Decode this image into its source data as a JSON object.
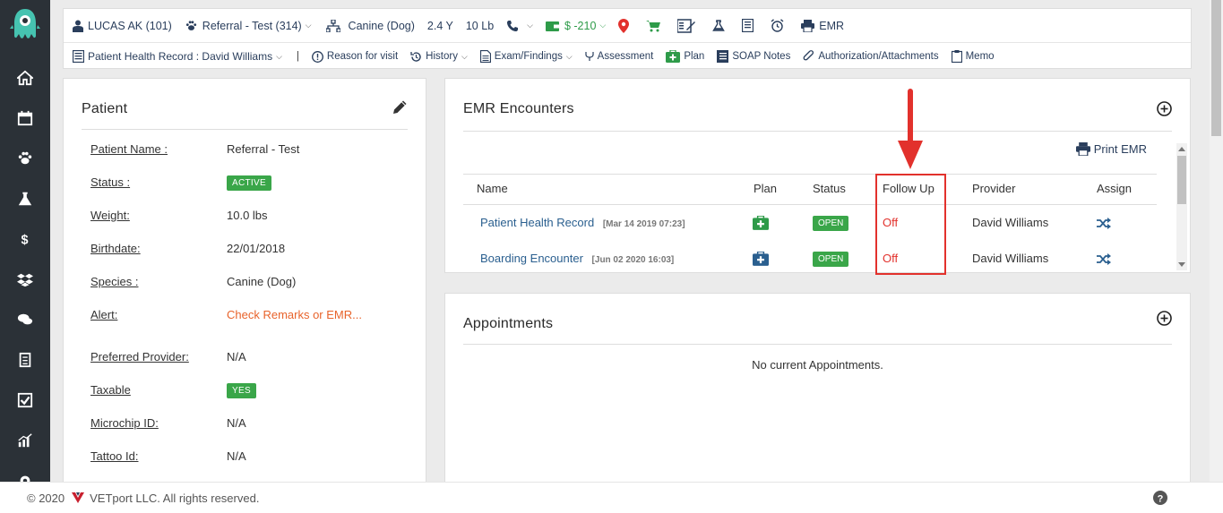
{
  "header": {
    "patient_owner": "LUCAS AK (101)",
    "patient_name": "Referral - Test (314)",
    "species": "Canine (Dog)",
    "age": "2.4 Y",
    "weight": "10 Lb",
    "balance": "$ -210",
    "emr_label": "EMR"
  },
  "subnav": {
    "record": "Patient Health Record : David Williams",
    "reason": "Reason for visit",
    "history": "History",
    "exam": "Exam/Findings",
    "assessment": "Assessment",
    "plan": "Plan",
    "soap": "SOAP Notes",
    "auth": "Authorization/Attachments",
    "memo": "Memo"
  },
  "patient": {
    "title": "Patient",
    "fields": [
      {
        "label": "Patient Name :",
        "value": "Referral - Test"
      },
      {
        "label": "Status :",
        "value": "ACTIVE"
      },
      {
        "label": "Weight:",
        "value": "10.0 lbs"
      },
      {
        "label": "Birthdate:",
        "value": "22/01/2018"
      },
      {
        "label": "Species :",
        "value": "Canine (Dog)"
      },
      {
        "label": "Alert:",
        "value": "Check Remarks or EMR..."
      },
      {
        "label": "Preferred Provider:",
        "value": "N/A"
      },
      {
        "label": "Taxable",
        "value": "YES"
      },
      {
        "label": "Microchip ID:",
        "value": "N/A"
      },
      {
        "label": "Tattoo Id:",
        "value": "N/A"
      }
    ]
  },
  "emr": {
    "title": "EMR Encounters",
    "print": "Print EMR",
    "columns": [
      "Name",
      "Plan",
      "Status",
      "Follow Up",
      "Provider",
      "Assign"
    ],
    "rows": [
      {
        "name": "Patient Health Record",
        "date": "[Mar 14 2019 07:23]",
        "status": "OPEN",
        "follow_up": "Off",
        "provider": "David Williams"
      },
      {
        "name": "Boarding Encounter",
        "date": "[Jun 02 2020 16:03]",
        "status": "OPEN",
        "follow_up": "Off",
        "provider": "David Williams"
      }
    ]
  },
  "appointments": {
    "title": "Appointments",
    "empty": "No current Appointments."
  },
  "footer": {
    "copyright": "© 2020",
    "company": "VETport LLC. All rights reserved."
  },
  "colors": {
    "sidebar": "#2b3137",
    "accent_green": "#3aa649",
    "alert_orange": "#e8632b",
    "highlight_red": "#e2312c",
    "link_blue": "#2a5f8f"
  }
}
